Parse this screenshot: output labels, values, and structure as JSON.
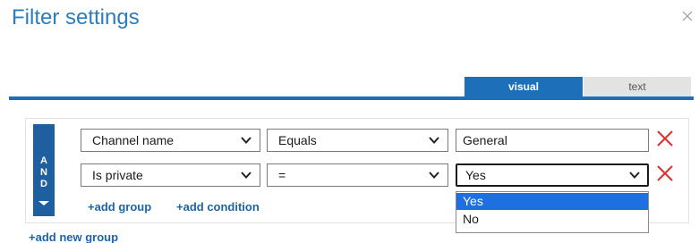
{
  "dialog": {
    "title": "Filter settings",
    "close_icon": "close-x-icon"
  },
  "tabs": [
    {
      "label": "visual",
      "active": true
    },
    {
      "label": "text",
      "active": false
    }
  ],
  "group": {
    "operator_letters": [
      "A",
      "N",
      "D"
    ],
    "rows": [
      {
        "field": "Channel name",
        "operator": "Equals",
        "value": "General",
        "value_type": "text"
      },
      {
        "field": "Is private",
        "operator": "=",
        "value": "Yes",
        "value_type": "select"
      }
    ],
    "add_group_label": "+add group",
    "add_condition_label": "+add condition"
  },
  "value_dropdown": {
    "options": [
      "Yes",
      "No"
    ],
    "highlighted": "Yes"
  },
  "add_new_group_label": "+add new group",
  "colors": {
    "accent": "#1e6fb9",
    "title": "#2b7dbf",
    "and_bar": "#1e5f9f",
    "remove": "#e03030",
    "dropdown_highlight": "#1e6fe0"
  }
}
